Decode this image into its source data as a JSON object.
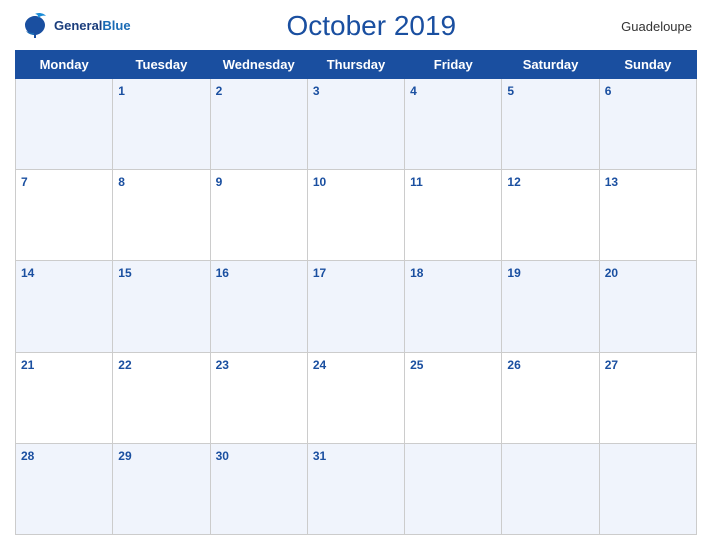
{
  "header": {
    "logo_general": "General",
    "logo_blue": "Blue",
    "title": "October 2019",
    "region": "Guadeloupe"
  },
  "weekdays": [
    "Monday",
    "Tuesday",
    "Wednesday",
    "Thursday",
    "Friday",
    "Saturday",
    "Sunday"
  ],
  "weeks": [
    [
      "",
      "1",
      "2",
      "3",
      "4",
      "5",
      "6"
    ],
    [
      "7",
      "8",
      "9",
      "10",
      "11",
      "12",
      "13"
    ],
    [
      "14",
      "15",
      "16",
      "17",
      "18",
      "19",
      "20"
    ],
    [
      "21",
      "22",
      "23",
      "24",
      "25",
      "26",
      "27"
    ],
    [
      "28",
      "29",
      "30",
      "31",
      "",
      "",
      ""
    ]
  ]
}
